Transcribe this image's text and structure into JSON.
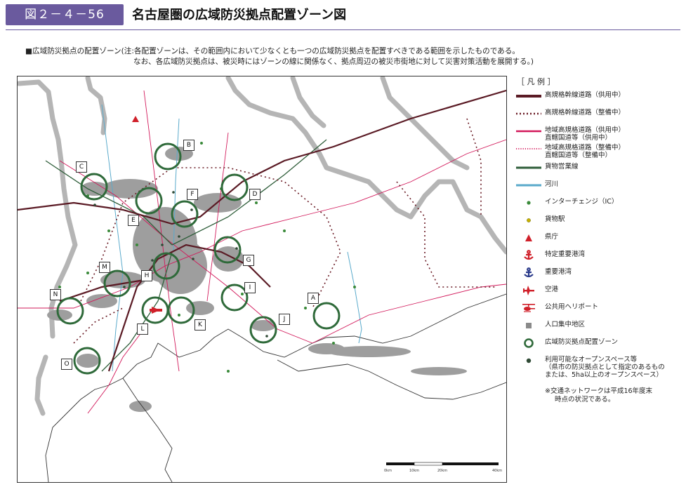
{
  "header": {
    "figure_number": "図２－４－56",
    "title": "名古屋圏の広域防災拠点配置ゾーン図"
  },
  "caption": {
    "line1": "■広域防災拠点の配置ゾーン(注:各配置ゾーンは、その範囲内において少なくとも一つの広域防災拠点を配置すべきである範囲を示したものである。",
    "line2": "なお、各広域防災拠点は、被災時にはゾーンの線に関係なく、拠点周辺の被災市街地に対して災害対策活動を展開する。)"
  },
  "map": {
    "zones": [
      {
        "label": "A"
      },
      {
        "label": "B"
      },
      {
        "label": "C"
      },
      {
        "label": "D"
      },
      {
        "label": "E"
      },
      {
        "label": "F"
      },
      {
        "label": "G"
      },
      {
        "label": "H"
      },
      {
        "label": "I"
      },
      {
        "label": "J"
      },
      {
        "label": "K"
      },
      {
        "label": "L"
      },
      {
        "label": "M"
      },
      {
        "label": "N"
      },
      {
        "label": "O"
      }
    ],
    "scale_labels": [
      "0km",
      "10km",
      "20km",
      "40km"
    ]
  },
  "legend": {
    "heading": "［ 凡 例 ］",
    "items": [
      {
        "id": "expressway-open",
        "icon": "thick-dark-line",
        "color": "#5a1a24",
        "label": "高規格幹線道路（供用中）"
      },
      {
        "id": "expressway-planned",
        "icon": "dotted-dark-line",
        "color": "#6a1a24",
        "label": "高規格幹線道路（整備中）"
      },
      {
        "id": "regional-open",
        "icon": "pink-line",
        "color": "#d2185a",
        "label": "地域高規格道路（供用中）",
        "label2": "直轄国道等（供用中）"
      },
      {
        "id": "regional-planned",
        "icon": "pink-dotted-line",
        "color": "#d2185a",
        "label": "地域高規格道路（整備中）",
        "label2": "直轄国道等（整備中）"
      },
      {
        "id": "freight-line",
        "icon": "green-line",
        "color": "#2f5e3a",
        "label": "貨物営業線"
      },
      {
        "id": "river",
        "icon": "blue-line",
        "color": "#5aaacb",
        "label": "河川"
      },
      {
        "id": "interchange",
        "icon": "green-dot",
        "color": "#3a8a3a",
        "label": "インターチェンジ（IC）"
      },
      {
        "id": "freight-station",
        "icon": "yellow-dot",
        "color": "#c8b000",
        "label": "貨物駅"
      },
      {
        "id": "prefectural-office",
        "icon": "red-triangle",
        "color": "#d0202a",
        "label": "県庁"
      },
      {
        "id": "special-port",
        "icon": "red-anchor",
        "color": "#d0202a",
        "label": "特定重要港湾"
      },
      {
        "id": "major-port",
        "icon": "blue-anchor",
        "color": "#2a3a8a",
        "label": "重要港湾"
      },
      {
        "id": "airport",
        "icon": "red-plane",
        "color": "#d0202a",
        "label": "空港"
      },
      {
        "id": "heliport",
        "icon": "red-helicopter",
        "color": "#d0202a",
        "label": "公共用ヘリポート"
      },
      {
        "id": "dense-area",
        "icon": "gray-square",
        "color": "#8a8a8a",
        "label": "人口集中地区"
      },
      {
        "id": "disaster-zone",
        "icon": "green-ring",
        "color": "#2f6a3a",
        "label": "広域防災拠点配置ゾーン"
      },
      {
        "id": "open-space",
        "icon": "dark-green-dot",
        "color": "#2f4a35",
        "label": "利用可能なオープンスペース等"
      }
    ],
    "open_space_note": [
      "（県市の防災拠点として指定のあるもの",
      "または、5ha以上のオープンスペース）"
    ],
    "footnote": [
      "※交通ネットワークは平成16年度末",
      "時点の状況である。"
    ]
  }
}
